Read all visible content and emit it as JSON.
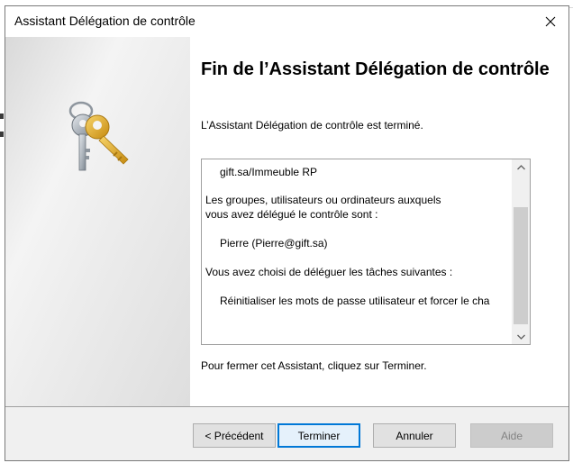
{
  "window": {
    "title": "Assistant Délégation de contrôle",
    "close_glyph": "✕"
  },
  "main": {
    "heading": "Fin de l’Assistant Délégation de contrôle",
    "subtitle": "L’Assistant Délégation de contrôle est terminé.",
    "summary_lines": [
      "gift.sa/Immeuble RP",
      "Les groupes, utilisateurs ou ordinateurs auxquels",
      "vous avez délégué le contrôle sont :",
      "Pierre (Pierre@gift.sa)",
      "Vous avez choisi de déléguer les tâches suivantes :",
      "Réinitialiser les mots de passe utilisateur et forcer le cha"
    ],
    "footer": "Pour fermer cet Assistant, cliquez sur Terminer."
  },
  "buttons": {
    "previous": "< Précédent",
    "finish": "Terminer",
    "cancel": "Annuler",
    "help": "Aide"
  },
  "icons": {
    "side": "keys-icon",
    "close": "close-icon",
    "scroll_up": "chevron-up-icon",
    "scroll_down": "chevron-down-icon"
  },
  "colors": {
    "accent": "#0078d7",
    "key_gold": "#d9a21c",
    "key_silver": "#9aa3ad"
  }
}
